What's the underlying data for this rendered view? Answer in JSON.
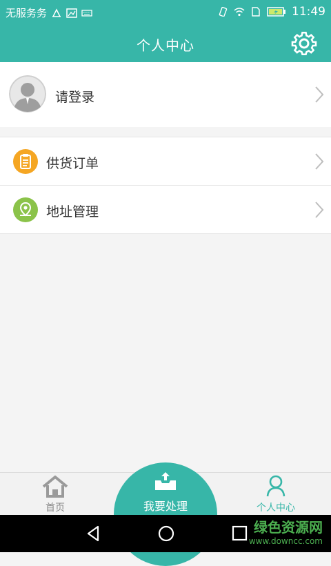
{
  "status_bar": {
    "carrier": "无服务务",
    "time": "11:49"
  },
  "header": {
    "title": "个人中心"
  },
  "profile": {
    "login_label": "请登录"
  },
  "menu": {
    "items": [
      {
        "label": "供货订单",
        "icon": "clipboard-icon"
      },
      {
        "label": "地址管理",
        "icon": "location-pin-icon"
      }
    ]
  },
  "tabbar": {
    "home": "首页",
    "center": "我要处理",
    "me": "个人中心"
  },
  "watermark": {
    "line1": "绿色资源网",
    "line2": "www.downcc.com"
  },
  "colors": {
    "accent": "#37b6a8",
    "orange": "#f5a623",
    "green": "#8bc34a"
  }
}
